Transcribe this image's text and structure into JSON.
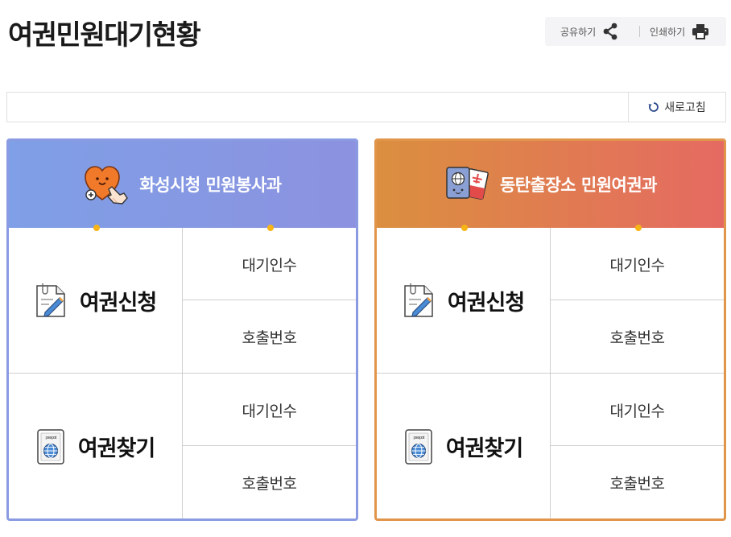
{
  "page": {
    "title": "여권민원대기현황"
  },
  "utility": {
    "share_label": "공유하기",
    "print_label": "인쇄하기"
  },
  "refresh": {
    "label": "새로고침"
  },
  "panels": [
    {
      "name": "화성시청 민원봉사과",
      "accent": "#8a9be2",
      "header_icon": "heart-hand-icon",
      "sections": [
        {
          "title": "여권신청",
          "icon": "document-pen-icon",
          "wait_label": "대기인수",
          "call_label": "호출번호"
        },
        {
          "title": "여권찾기",
          "icon": "passport-icon",
          "wait_label": "대기인수",
          "call_label": "호출번호"
        }
      ]
    },
    {
      "name": "동탄출장소 민원여권과",
      "accent": "#e1954a",
      "header_icon": "passport-ticket-icon",
      "sections": [
        {
          "title": "여권신청",
          "icon": "document-pen-icon",
          "wait_label": "대기인수",
          "call_label": "호출번호"
        },
        {
          "title": "여권찾기",
          "icon": "passport-icon",
          "wait_label": "대기인수",
          "call_label": "호출번호"
        }
      ]
    }
  ]
}
